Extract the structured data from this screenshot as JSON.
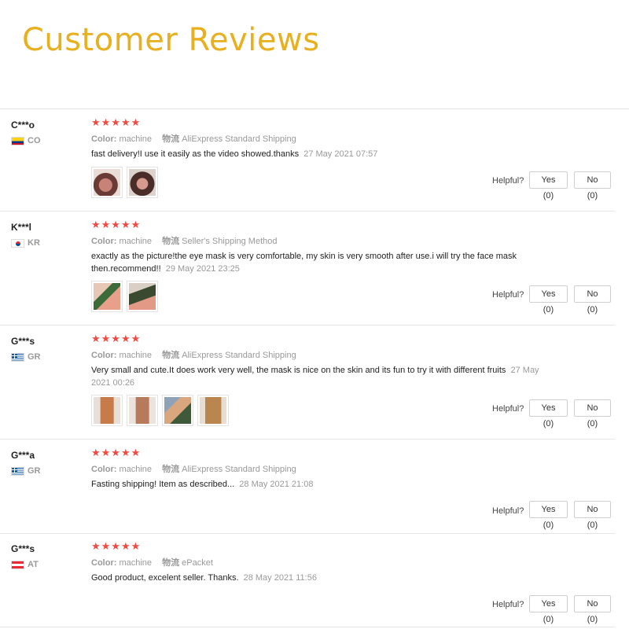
{
  "page": {
    "title": "Customer Reviews"
  },
  "labels": {
    "color_label": "Color:",
    "shipping_label": "物流",
    "helpful_label": "Helpful?"
  },
  "reviews": [
    {
      "user": "C***o",
      "country": "CO",
      "flag": "colombia",
      "stars": "★★★★★",
      "rating": 5,
      "color": "machine",
      "shipping": "AliExpress Standard Shipping",
      "text": "fast delivery!I use it easily as the video showed.thanks",
      "date": "27 May 2021 07:57",
      "yes": "Yes (0)",
      "no": "No (0)",
      "photo_count": 2
    },
    {
      "user": "K***l",
      "country": "KR",
      "flag": "south-korea",
      "stars": "★★★★★",
      "rating": 5,
      "color": "machine",
      "shipping": "Seller's Shipping Method",
      "text": "exactly as the picture!the eye mask is very comfortable, my skin is very smooth after use.i will try the face mask then.recommend!!",
      "date": "29 May 2021 23:25",
      "yes": "Yes (0)",
      "no": "No (0)",
      "photo_count": 2
    },
    {
      "user": "G***s",
      "country": "GR",
      "flag": "greece",
      "stars": "★★★★★",
      "rating": 5,
      "color": "machine",
      "shipping": "AliExpress Standard Shipping",
      "text": "Very small and cute.It does work very well, the mask is nice on the skin and its fun to try it with different fruits",
      "date": "27 May 2021 00:26",
      "yes": "Yes (0)",
      "no": "No (0)",
      "photo_count": 4
    },
    {
      "user": "G***a",
      "country": "GR",
      "flag": "greece",
      "stars": "★★★★★",
      "rating": 5,
      "color": "machine",
      "shipping": "AliExpress Standard Shipping",
      "text": "Fasting shipping! Item as described...",
      "date": "28 May 2021 21:08",
      "yes": "Yes (0)",
      "no": "No (0)",
      "photo_count": 0
    },
    {
      "user": "G***s",
      "country": "AT",
      "flag": "austria",
      "stars": "★★★★★",
      "rating": 5,
      "color": "machine",
      "shipping": "ePacket",
      "text": "Good product, excelent seller. Thanks.",
      "date": "28 May 2021 11:56",
      "yes": "Yes (0)",
      "no": "No (0)",
      "photo_count": 0
    }
  ]
}
